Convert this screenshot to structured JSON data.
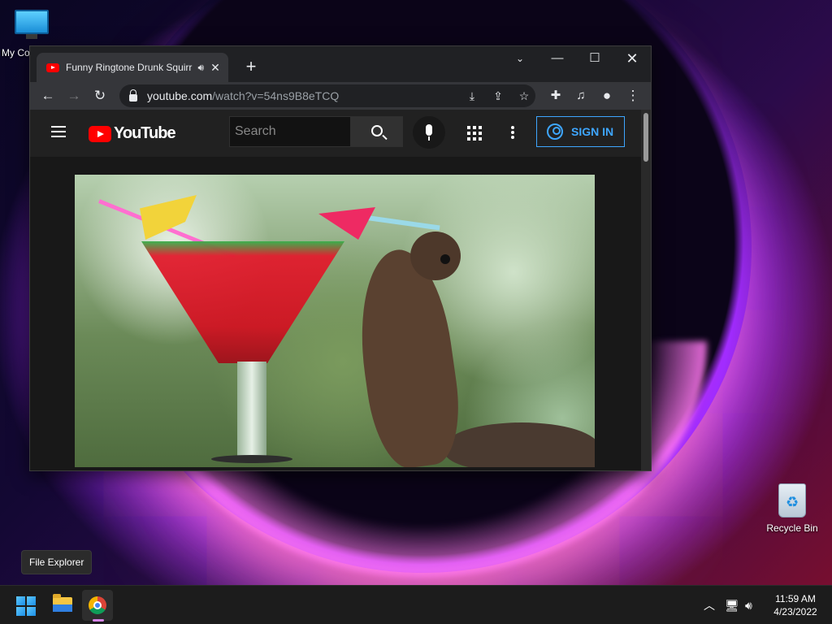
{
  "desktop": {
    "icons": [
      {
        "label": "My Co"
      },
      {
        "label": "Recycle Bin"
      }
    ]
  },
  "browser": {
    "tab": {
      "title": "Funny Ringtone Drunk Squirr",
      "audio_icon": "speaker-icon",
      "close_glyph": "✕"
    },
    "new_tab_glyph": "+",
    "window_controls": {
      "chevron": "⌄",
      "minimize": "—",
      "maximize": "☐",
      "close": "✕"
    },
    "toolbar": {
      "back": "←",
      "forward": "→",
      "reload": "↻",
      "url_host": "youtube.com",
      "url_path": "/watch?v=54ns9B8eTCQ"
    }
  },
  "youtube": {
    "logo_text": "YouTube",
    "search_placeholder": "Search",
    "sign_in_label": "SIGN IN",
    "accent": "#3ea6ff",
    "brand_red": "#ff0000"
  },
  "taskbar": {
    "tooltip": "File Explorer",
    "time": "11:59 AM",
    "date": "4/23/2022"
  }
}
